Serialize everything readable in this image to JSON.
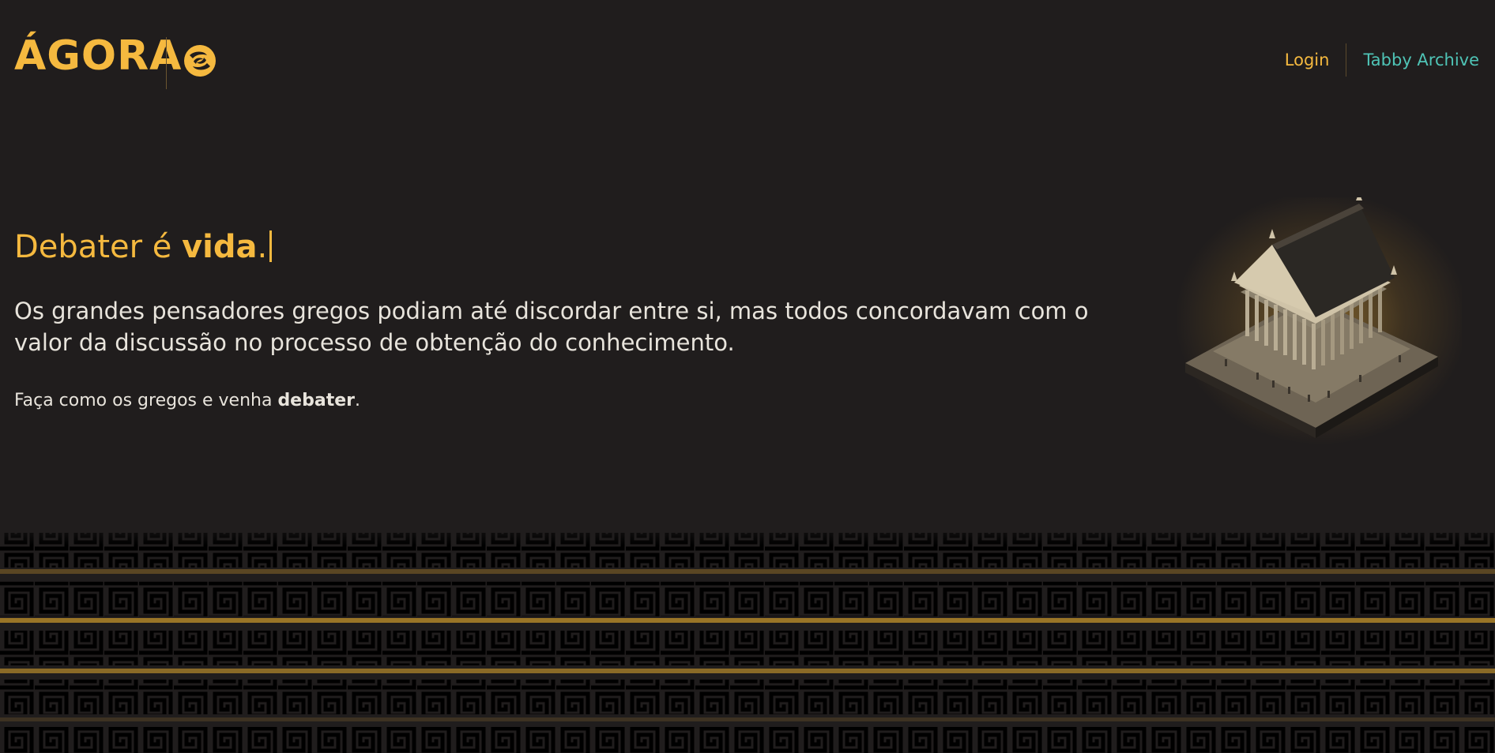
{
  "header": {
    "logo_text": "ÁGORA",
    "emblem_icon": "swirl-emblem-icon",
    "nav": {
      "login_label": "Login",
      "archive_label": "Tabby Archive"
    }
  },
  "hero": {
    "title_prefix": "Debater é ",
    "title_bold": "vida",
    "title_suffix": ".",
    "description": "Os grandes pensadores gregos podiam até discordar entre si, mas todos concordavam com o valor da discussão no processo de obtenção do conhecimento.",
    "cta_prefix": "Faça como os gregos e venha ",
    "cta_bold": "debater",
    "cta_suffix": "."
  },
  "illustration": {
    "icon": "greek-temple-illustration"
  },
  "colors": {
    "background": "#201d1d",
    "gold": "#f5b93f",
    "teal": "#4fc4b6",
    "text": "#e8e4dc"
  }
}
